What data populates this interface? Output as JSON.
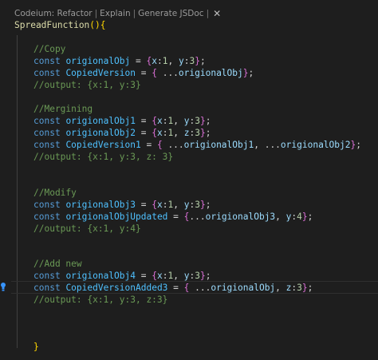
{
  "codelens": {
    "refactor": "Codeium: Refactor",
    "explain": "Explain",
    "generate": "Generate JSDoc",
    "sep": "|",
    "close": "✕"
  },
  "icons": {
    "lightbulb": "lightbulb-icon",
    "close": "close-icon"
  },
  "colors": {
    "background": "#1e1e1e",
    "keyword": "#569cd6",
    "constant": "#4fc1ff",
    "variable": "#9cdcfe",
    "function": "#dcdcaa",
    "comment": "#6a9955",
    "bracket_outer": "#ffd700",
    "bracket_inner": "#da70d6"
  },
  "code": {
    "decl": "SpreadFunction",
    "decl_paren_open": "(",
    "decl_paren_close": ")",
    "decl_brace_open": "{",
    "decl_brace_close": "}",
    "blocks": {
      "copy": {
        "comment": "//Copy",
        "line1": {
          "kw": "const",
          "name": "origionalObj",
          "eq": " = ",
          "open": "{",
          "x": "x",
          "xv": "1",
          "y": "y",
          "yv": "3",
          "close": "}",
          "end": ";"
        },
        "line2": {
          "kw": "const",
          "name": "CopiedVersion",
          "eq": " = ",
          "open": "{",
          "spread": " ...",
          "ref": "origionalObj",
          "close": "}",
          "end": ";"
        },
        "output": "//output: {x:1, y:3}"
      },
      "merge": {
        "comment": "//Mergining",
        "line1": {
          "kw": "const",
          "name": "origionalObj1",
          "eq": " = ",
          "open": "{",
          "x": "x",
          "xv": "1",
          "y": "y",
          "yv": "3",
          "close": "}",
          "end": ";"
        },
        "line2": {
          "kw": "const",
          "name": "origionalObj2",
          "eq": " = ",
          "open": "{",
          "x": "x",
          "xv": "1",
          "z": "z",
          "zv": "3",
          "close": "}",
          "end": ";"
        },
        "line3": {
          "kw": "const",
          "name": "CopiedVersion1",
          "eq": " = ",
          "open": "{",
          "spread1": " ...",
          "ref1": "origionalObj1",
          "comma": ",",
          "spread2": " ...",
          "ref2": "origionalObj2",
          "close": "}",
          "end": ";"
        },
        "output": "//output: {x:1, y:3, z: 3}"
      },
      "modify": {
        "comment": "//Modify",
        "line1": {
          "kw": "const",
          "name": "origionalObj3",
          "eq": " = ",
          "open": "{",
          "x": "x",
          "xv": "1",
          "y": "y",
          "yv": "3",
          "close": "}",
          "end": ";"
        },
        "line2": {
          "kw": "const",
          "name": "origionalObjUpdated",
          "eq": " = ",
          "open": "{",
          "spread": "...",
          "ref": "origionalObj3",
          "y": "y",
          "yv": "4",
          "close": "}",
          "end": ";"
        },
        "output": "//output: {x:1, y:4}"
      },
      "addnew": {
        "comment": "//Add new",
        "line1": {
          "kw": "const",
          "name": "origionalObj4",
          "eq": " = ",
          "open": "{",
          "x": "x",
          "xv": "1",
          "y": "y",
          "yv": "3",
          "close": "}",
          "end": ";"
        },
        "line2": {
          "kw": "const",
          "name": "CopiedVersionAdded3",
          "eq": " = ",
          "open": "{",
          "spread": " ...",
          "ref": "origionalObj",
          "z": "z",
          "zv": "3",
          "close": "}",
          "end": ";"
        },
        "output": "//output: {x:1, y:3, z:3}"
      }
    }
  }
}
